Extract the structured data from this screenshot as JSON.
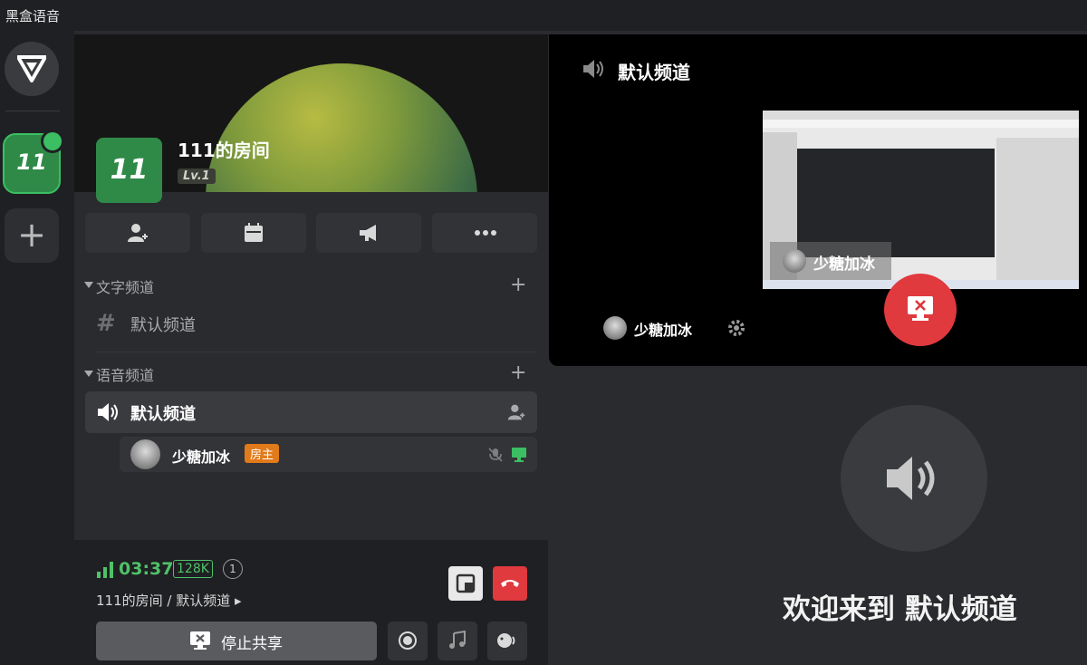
{
  "app": {
    "title": "黑盒语音"
  },
  "rail": {
    "server_number": "11",
    "add_label": "+"
  },
  "room": {
    "icon_text": "11",
    "title": "111的房间",
    "level": "Lv.1"
  },
  "sections": {
    "text": {
      "label": "文字频道",
      "add": "+",
      "channels": [
        {
          "icon": "#",
          "name": "默认频道"
        }
      ]
    },
    "voice": {
      "label": "语音频道",
      "add": "+",
      "channels": [
        {
          "name": "默认频道"
        }
      ]
    }
  },
  "member": {
    "name": "少糖加冰",
    "badge": "房主"
  },
  "status": {
    "timer": "03:37",
    "bitrate": "128K",
    "count": "1",
    "path": "111的房间 / 默认频道 ▸"
  },
  "controls": {
    "stop_share": "停止共享"
  },
  "video": {
    "title": "默认频道",
    "sharer_overlay": "少糖加冰",
    "sharer_name": "少糖加冰"
  },
  "welcome": "欢迎来到 默认频道",
  "colors": {
    "green": "#3bbf62",
    "red": "#e0393e",
    "orange": "#e07a1a"
  }
}
